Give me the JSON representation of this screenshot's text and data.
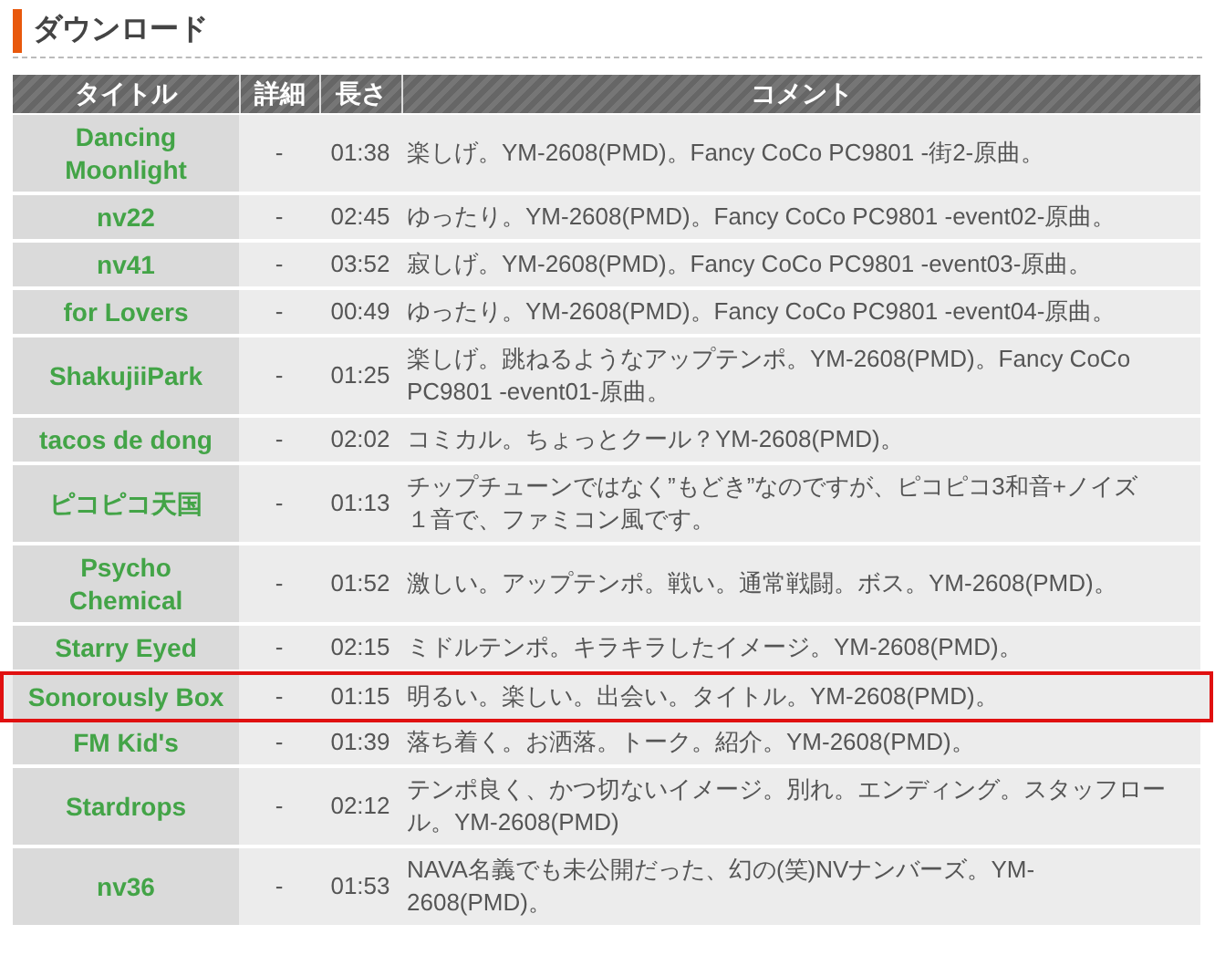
{
  "section": {
    "title": "ダウンロード"
  },
  "table": {
    "columns": [
      "タイトル",
      "詳細",
      "長さ",
      "コメント"
    ],
    "rows": [
      {
        "title_lines": [
          "Dancing",
          "Moonlight"
        ],
        "detail": "-",
        "length": "01:38",
        "comment_lines": [
          "楽しげ。YM-2608(PMD)。Fancy CoCo PC9801 -街2-原曲。"
        ],
        "highlighted": false
      },
      {
        "title_lines": [
          "nv22"
        ],
        "detail": "-",
        "length": "02:45",
        "comment_lines": [
          "ゆったり。YM-2608(PMD)。Fancy CoCo PC9801 -event02-原曲。"
        ],
        "highlighted": false
      },
      {
        "title_lines": [
          "nv41"
        ],
        "detail": "-",
        "length": "03:52",
        "comment_lines": [
          "寂しげ。YM-2608(PMD)。Fancy CoCo PC9801 -event03-原曲。"
        ],
        "highlighted": false
      },
      {
        "title_lines": [
          "for Lovers"
        ],
        "detail": "-",
        "length": "00:49",
        "comment_lines": [
          "ゆったり。YM-2608(PMD)。Fancy CoCo PC9801 -event04-原曲。"
        ],
        "highlighted": false
      },
      {
        "title_lines": [
          "ShakujiiPark"
        ],
        "detail": "-",
        "length": "01:25",
        "comment_lines": [
          "楽しげ。跳ねるようなアップテンポ。YM-2608(PMD)。Fancy CoCo",
          "PC9801 -event01-原曲。"
        ],
        "highlighted": false
      },
      {
        "title_lines": [
          "tacos de dong"
        ],
        "detail": "-",
        "length": "02:02",
        "comment_lines": [
          "コミカル。ちょっとクール？YM-2608(PMD)。"
        ],
        "highlighted": false
      },
      {
        "title_lines": [
          "ピコピコ天国"
        ],
        "detail": "-",
        "length": "01:13",
        "comment_lines": [
          "チップチューンではなく”もどき”なのですが、ピコピコ3和音+ノイズ",
          "１音で、ファミコン風です。"
        ],
        "highlighted": false
      },
      {
        "title_lines": [
          "Psycho",
          "Chemical"
        ],
        "detail": "-",
        "length": "01:52",
        "comment_lines": [
          "激しい。アップテンポ。戦い。通常戦闘。ボス。YM-2608(PMD)。"
        ],
        "highlighted": false
      },
      {
        "title_lines": [
          "Starry Eyed"
        ],
        "detail": "-",
        "length": "02:15",
        "comment_lines": [
          "ミドルテンポ。キラキラしたイメージ。YM-2608(PMD)。"
        ],
        "highlighted": false
      },
      {
        "title_lines": [
          "Sonorously Box"
        ],
        "detail": "-",
        "length": "01:15",
        "comment_lines": [
          "明るい。楽しい。出会い。タイトル。YM-2608(PMD)。"
        ],
        "highlighted": true
      },
      {
        "title_lines": [
          "FM Kid's"
        ],
        "detail": "-",
        "length": "01:39",
        "comment_lines": [
          "落ち着く。お洒落。トーク。紹介。YM-2608(PMD)。"
        ],
        "highlighted": false
      },
      {
        "title_lines": [
          "Stardrops"
        ],
        "detail": "-",
        "length": "02:12",
        "comment_lines": [
          "テンポ良く、かつ切ないイメージ。別れ。エンディング。スタッフロー",
          "ル。YM-2608(PMD)"
        ],
        "highlighted": false
      },
      {
        "title_lines": [
          "nv36"
        ],
        "detail": "-",
        "length": "01:53",
        "comment_lines": [
          "NAVA名義でも未公開だった、幻の(笑)NVナンバーズ。YM-",
          "2608(PMD)。"
        ],
        "highlighted": false
      }
    ]
  }
}
